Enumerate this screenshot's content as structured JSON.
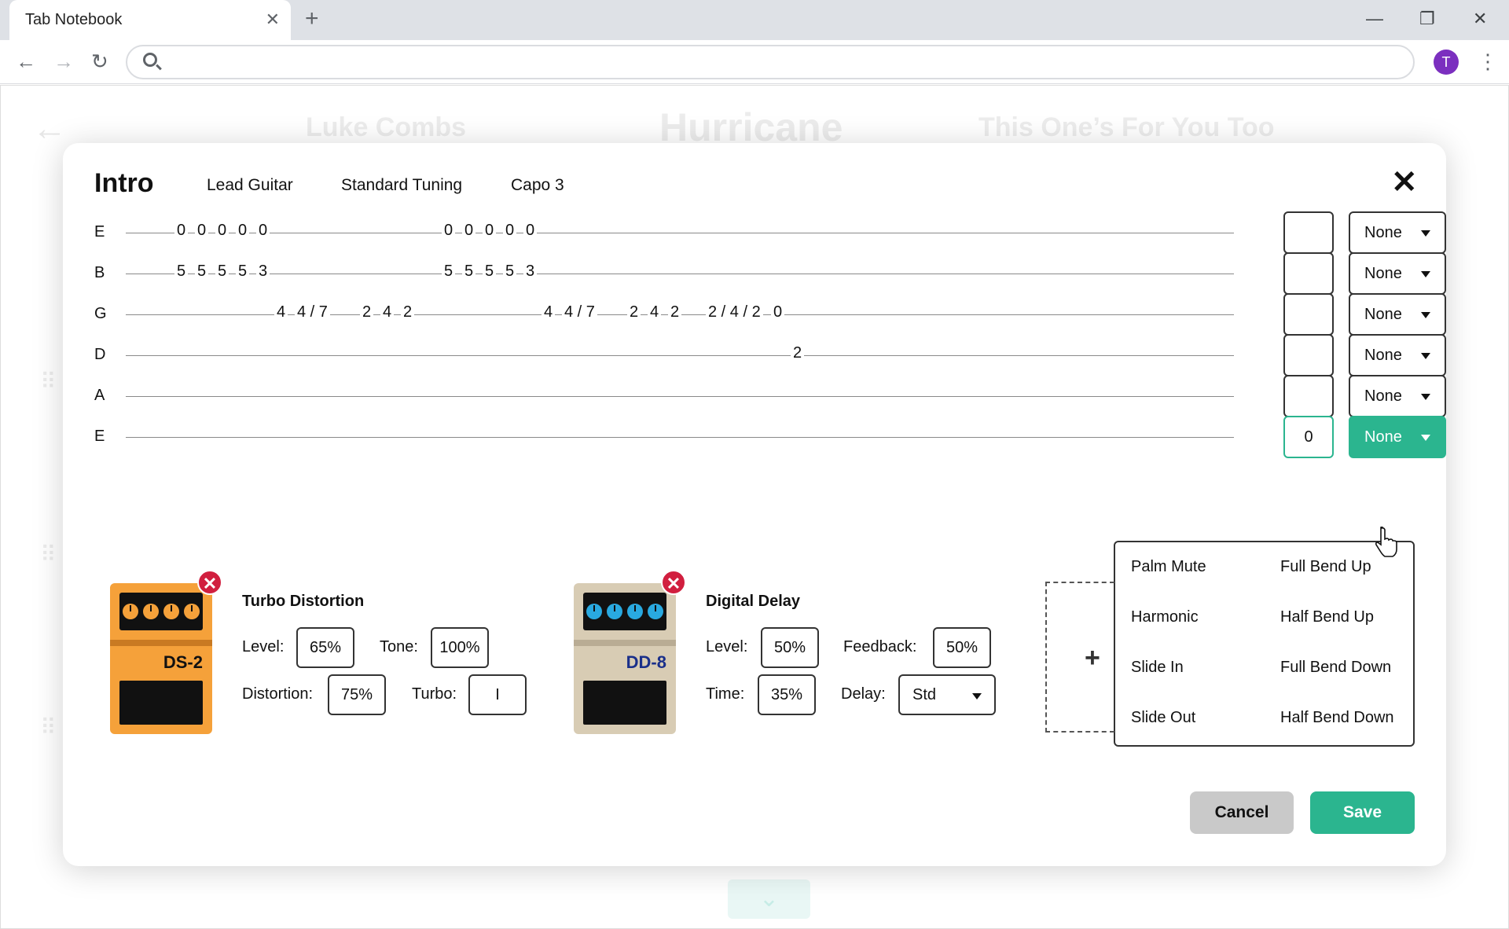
{
  "browser": {
    "tab_title": "Tab Notebook",
    "tab_close": "✕",
    "new_tab": "+",
    "minimize": "—",
    "restore": "❐",
    "close": "✕",
    "back": "←",
    "forward": "→",
    "reload": "↻",
    "address": "",
    "profile_initial": "T",
    "menu": "⋮"
  },
  "background": {
    "back_arrow": "←",
    "prev_song": "Luke Combs",
    "current_song": "Hurricane",
    "next_song": "This One’s For You Too",
    "drag_handle": "⠿",
    "chevron": "⌄"
  },
  "modal": {
    "title": "Intro",
    "part": "Lead Guitar",
    "tuning": "Standard Tuning",
    "capo": "Capo 3",
    "close": "✕"
  },
  "strings": [
    {
      "name": "E",
      "fret_value": "",
      "technique": "None",
      "active": false,
      "notes": [
        "0",
        "0",
        "0",
        "0",
        "0",
        "0",
        "0",
        "0",
        "0",
        "0"
      ]
    },
    {
      "name": "B",
      "fret_value": "",
      "technique": "None",
      "active": false,
      "notes": [
        "5",
        "5",
        "5",
        "5",
        "3",
        "5",
        "5",
        "5",
        "5",
        "3"
      ]
    },
    {
      "name": "G",
      "fret_value": "",
      "technique": "None",
      "active": false,
      "notes": [
        "4",
        "4 / 7",
        "2",
        "4",
        "2",
        "4",
        "4 / 7",
        "2",
        "4",
        "2",
        "2 / 4 / 2",
        "0"
      ]
    },
    {
      "name": "D",
      "fret_value": "",
      "technique": "None",
      "active": false,
      "notes": [
        "2"
      ]
    },
    {
      "name": "A",
      "fret_value": "",
      "technique": "None",
      "active": false,
      "notes": []
    },
    {
      "name": "E",
      "fret_value": "0",
      "technique": "None",
      "active": true,
      "notes": []
    }
  ],
  "technique_menu": {
    "col1": [
      "Palm Mute",
      "Harmonic",
      "Slide In",
      "Slide Out"
    ],
    "col2": [
      "Full Bend Up",
      "Half Bend Up",
      "Full Bend Down",
      "Half Bend Down"
    ]
  },
  "pedals": [
    {
      "name": "Turbo Distortion",
      "model": "DS-2",
      "color": "#f5a13a",
      "knob_color": "#f5a13a",
      "model_color": "#111111",
      "params": {
        "level_label": "Level:",
        "level": "65%",
        "tone_label": "Tone:",
        "tone": "100%",
        "distortion_label": "Distortion:",
        "distortion": "75%",
        "turbo_label": "Turbo:",
        "turbo": "I"
      }
    },
    {
      "name": "Digital Delay",
      "model": "DD-8",
      "color": "#d8ccb4",
      "knob_color": "#29a9e0",
      "model_color": "#1a2f8a",
      "params": {
        "level_label": "Level:",
        "level": "50%",
        "feedback_label": "Feedback:",
        "feedback": "50%",
        "time_label": "Time:",
        "time": "35%",
        "delay_label": "Delay:",
        "delay": "Std"
      }
    }
  ],
  "pedal_remove": "✕",
  "add_pedal": "+",
  "buttons": {
    "cancel": "Cancel",
    "save": "Save"
  },
  "colors": {
    "accent": "#2bb58f",
    "danger": "#d11f3f"
  }
}
